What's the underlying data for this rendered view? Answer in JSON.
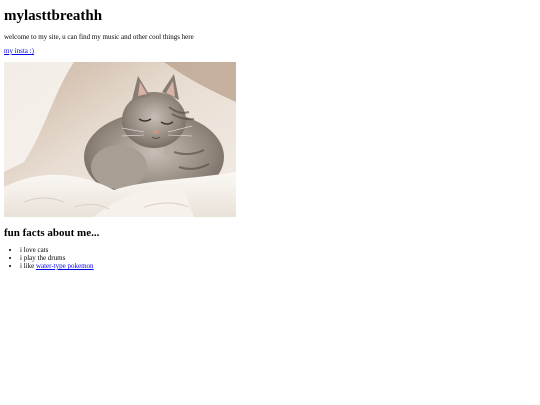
{
  "header": {
    "title": "mylasttbreathh"
  },
  "intro": {
    "text": "welcome to my site, u can find my music and other cool things here"
  },
  "links": {
    "insta": "my insta :)"
  },
  "image": {
    "subject": "sleeping-kitten-photo"
  },
  "facts": {
    "heading": "fun facts about me...",
    "items": [
      {
        "text": "i love cats"
      },
      {
        "text": "i play the drums"
      },
      {
        "prefix": "i like ",
        "link": "water-type pokemon"
      }
    ]
  }
}
